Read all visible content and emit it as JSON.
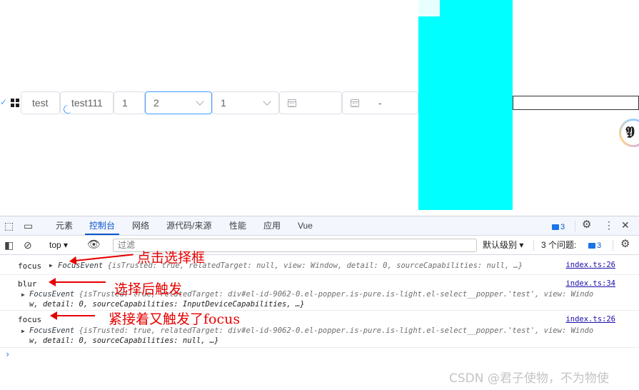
{
  "form": {
    "input_a": "test",
    "input_b": "test111",
    "number_value": "1",
    "select_a": "2",
    "select_b": "1",
    "range_separator": "-"
  },
  "devtools": {
    "tabs": [
      "元素",
      "控制台",
      "网络",
      "源代码/来源",
      "性能",
      "应用",
      "Vue"
    ],
    "active_tab": "控制台",
    "messages_count": "3",
    "context": "top",
    "filter_placeholder": "过滤",
    "log_level": "默认级别",
    "issues_label": "3 个问题:",
    "issues_count": "3"
  },
  "console": {
    "entries": [
      {
        "label": "focus",
        "source": "index.ts:26",
        "event": "FocusEvent",
        "line1": "{isTrusted: true, relatedTarget: null, view: Window, detail: 0, sourceCapabilities: null, …}"
      },
      {
        "label": "blur",
        "source": "index.ts:34",
        "event": "FocusEvent",
        "line1": "{isTrusted: true, relatedTarget: div#el-id-9062-0.el-popper.is-pure.is-light.el-select__popper.'test', view: Windo",
        "line2": "w, detail: 0, sourceCapabilities: InputDeviceCapabilities, …}"
      },
      {
        "label": "focus",
        "source": "index.ts:26",
        "event": "FocusEvent",
        "line1": "{isTrusted: true, relatedTarget: div#el-id-9062-0.el-popper.is-pure.is-light.el-select__popper.'test', view: Windo",
        "line2": "w, detail: 0, sourceCapabilities: null, …}"
      }
    ]
  },
  "annotations": [
    "点击选择框",
    "选择后触发",
    "紧接着又触发了focus"
  ],
  "watermark": "CSDN @君子使物，不为物使",
  "colors": {
    "cyan_block": "#00ffff",
    "annotation": "#e60000",
    "accent": "#409eff",
    "devtools_active": "#0b57d0"
  }
}
